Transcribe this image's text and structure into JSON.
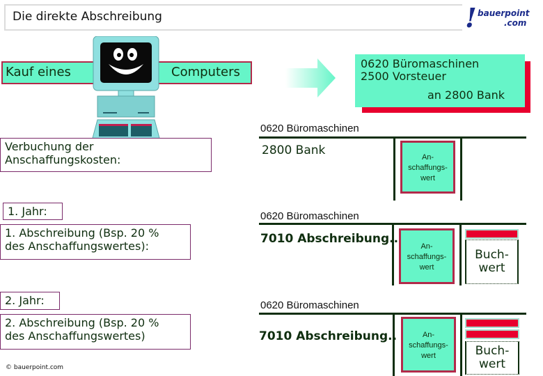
{
  "header": {
    "title": "Die direkte Abschreibung",
    "logo": {
      "mark": "!",
      "line1": "bauerpoint",
      "line2": ".com"
    }
  },
  "banner": {
    "left_text": "Kauf eines",
    "right_text": "Computers",
    "illustration": "computer-icon"
  },
  "booking": {
    "line1": "0620 Büromaschinen",
    "line2": "2500 Vorsteuer",
    "line3": "an 2800 Bank"
  },
  "colors": {
    "mint": "#66f5c8",
    "red": "#e8002e",
    "border_red": "#b22a4a",
    "dark_green": "#0f2e0f",
    "purple_border": "#7a2a6a"
  },
  "steps": [
    {
      "label": "Verbuchung der\nAnschaffungskosten:"
    },
    {
      "year": "1. Jahr:",
      "label": "1. Abschreibung (Bsp. 20 %\ndes Anschaffungswertes):"
    },
    {
      "year": "2. Jahr:",
      "label": "2. Abschreibung (Bsp. 20 %\ndes Anschaffungswertes)"
    }
  ],
  "accounts": [
    {
      "title": "0620 Büromaschinen",
      "entry": "2800 Bank",
      "asset_label": "An-\nschaffungs-\nwert",
      "depreciation_bars": 0,
      "book_value": ""
    },
    {
      "title": "0620 Büromaschinen",
      "entry": "7010 Abschreibung..",
      "asset_label": "An-\nschaffungs-\nwert",
      "depreciation_bars": 1,
      "book_value": "Buch-\nwert"
    },
    {
      "title": "0620 Büromaschinen",
      "entry": "7010 Abschreibung..",
      "asset_label": "An-\nschaffungs-\nwert",
      "depreciation_bars": 2,
      "book_value": "Buch-\nwert"
    }
  ],
  "footer": {
    "copyright": "© bauerpoint.com"
  }
}
